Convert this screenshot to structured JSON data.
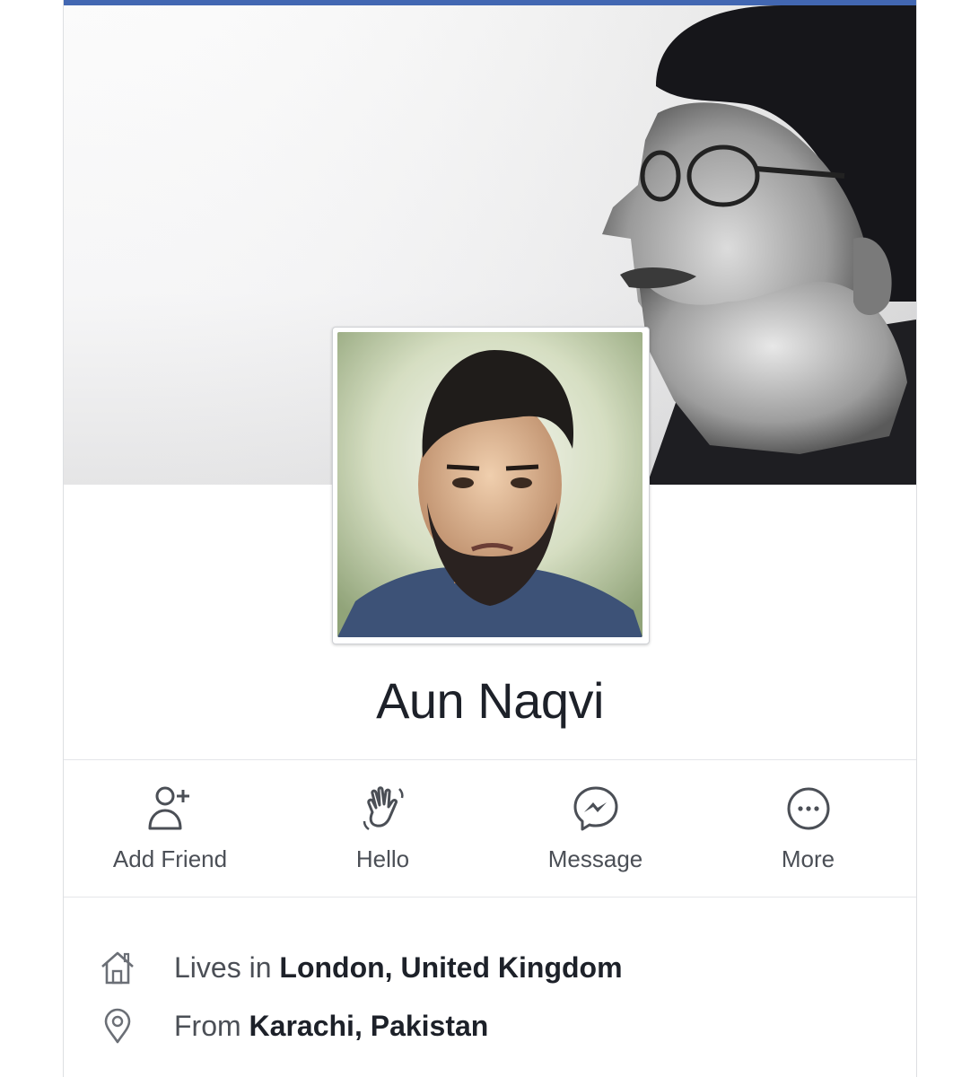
{
  "profile": {
    "name": "Aun Naqvi"
  },
  "actions": [
    {
      "label": "Add Friend",
      "icon": "add-friend-icon"
    },
    {
      "label": "Hello",
      "icon": "wave-icon"
    },
    {
      "label": "Message",
      "icon": "messenger-icon"
    },
    {
      "label": "More",
      "icon": "more-icon"
    }
  ],
  "about": {
    "lives": {
      "prefix": "Lives in",
      "place": "London, United Kingdom",
      "icon": "home-icon"
    },
    "from": {
      "prefix": "From",
      "place": "Karachi, Pakistan",
      "icon": "location-pin-icon"
    }
  },
  "colors": {
    "brand": "#4267b2",
    "text": "#1d2129",
    "secondary": "#4b4f56"
  }
}
